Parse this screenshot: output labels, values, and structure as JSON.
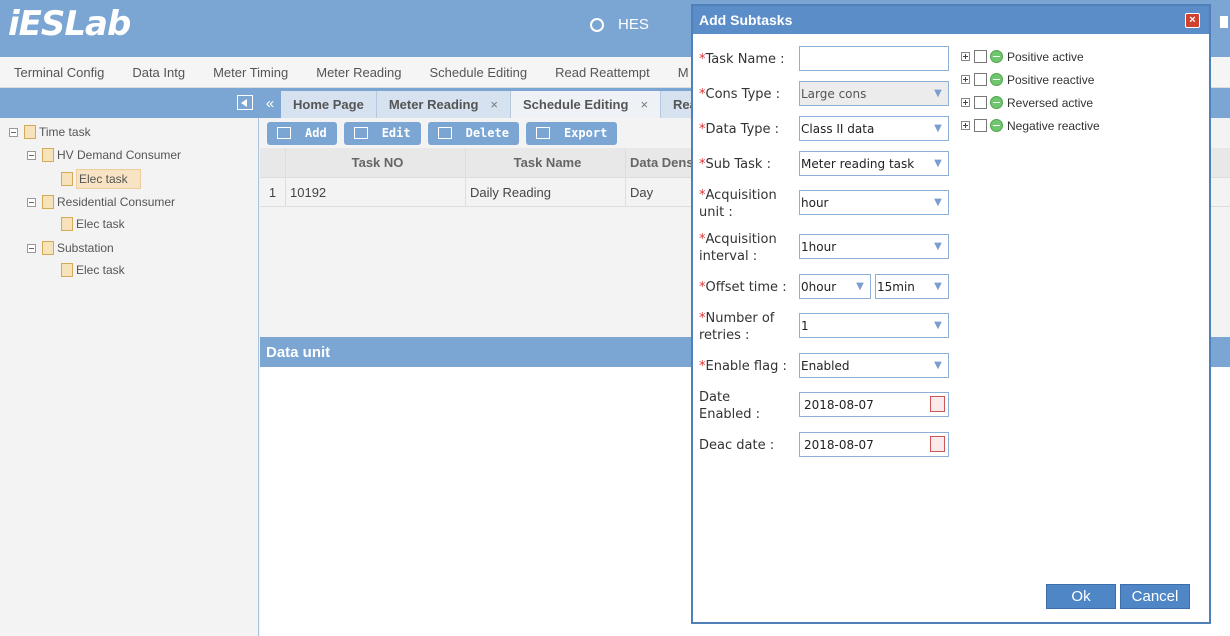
{
  "header": {
    "logo": "iESLab",
    "system": "HES"
  },
  "topmenu": [
    "Terminal Config",
    "Data Intg",
    "Meter Timing",
    "Meter Reading",
    "Schedule Editing",
    "Read Reattempt",
    "M"
  ],
  "tree": {
    "root": "Time task",
    "groups": [
      {
        "label": "HV Demand Consumer",
        "child": "Elec task"
      },
      {
        "label": "Residential Consumer",
        "child": "Elec task"
      },
      {
        "label": "Substation",
        "child": "Elec task"
      }
    ]
  },
  "tabs": [
    {
      "label": "Home Page",
      "closable": false
    },
    {
      "label": "Meter Reading",
      "closable": true
    },
    {
      "label": "Schedule Editing",
      "closable": true
    },
    {
      "label": "Rea",
      "closable": false
    }
  ],
  "toolbar": {
    "add": "Add",
    "edit": "Edit",
    "delete": "Delete",
    "export": "Export"
  },
  "grid": {
    "columns": [
      "",
      "Task NO",
      "Task Name",
      "Data Dens"
    ],
    "rows": [
      [
        "1",
        "10192",
        "Daily Reading",
        "Day"
      ]
    ]
  },
  "data_unit_title": "Data unit",
  "dialog": {
    "title": "Add Subtasks",
    "close": "×",
    "fields": {
      "task_name": {
        "label": "Task Name :",
        "value": ""
      },
      "cons_type": {
        "label": "Cons Type :",
        "value": "Large cons"
      },
      "data_type": {
        "label": "Data Type :",
        "value": "Class II data"
      },
      "sub_task": {
        "label": "Sub Task :",
        "value": "Meter reading task"
      },
      "acq_unit": {
        "label1": "Acquisition",
        "label2": "unit :",
        "value": "hour"
      },
      "acq_interval": {
        "label1": "Acquisition",
        "label2": "interval :",
        "value": "1hour"
      },
      "offset_time": {
        "label": "Offset time :",
        "hour": "0hour",
        "min": "15min"
      },
      "retries": {
        "label1": "Number of",
        "label2": "retries :",
        "value": "1"
      },
      "enable_flag": {
        "label": "Enable flag :",
        "value": "Enabled"
      },
      "date_enabled": {
        "label1": "Date",
        "label2": "Enabled :",
        "value": "2018-08-07"
      },
      "deac_date": {
        "label": "Deac date :",
        "value": "2018-08-07"
      }
    },
    "checklist": [
      "Positive active",
      "Positive reactive",
      "Reversed active",
      "Negative reactive"
    ],
    "ok": "Ok",
    "cancel": "Cancel"
  }
}
